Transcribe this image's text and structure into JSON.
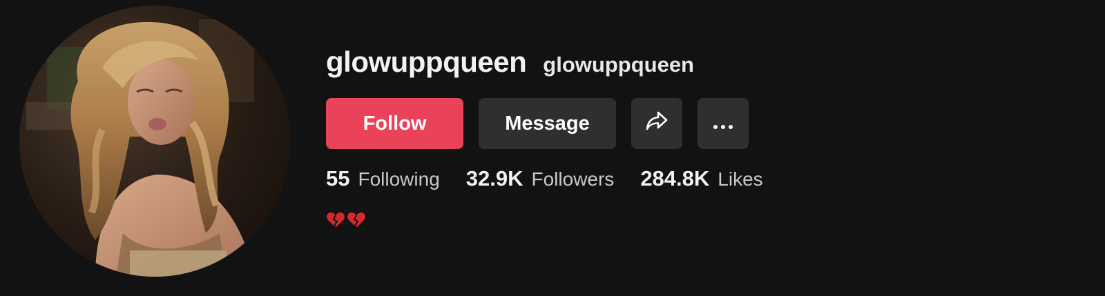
{
  "profile": {
    "username": "glowuppqueen",
    "nickname": "glowuppqueen",
    "avatar_icon": "profile-photo"
  },
  "actions": {
    "follow_label": "Follow",
    "message_label": "Message",
    "share_icon": "share-arrow-icon",
    "more_icon": "more-dots-icon"
  },
  "stats": {
    "following": {
      "count": "55",
      "label": "Following"
    },
    "followers": {
      "count": "32.9K",
      "label": "Followers"
    },
    "likes": {
      "count": "284.8K",
      "label": "Likes"
    }
  },
  "bio": {
    "emoji_icon": "broken-heart-icon"
  },
  "colors": {
    "background": "#121212",
    "follow_button": "#ea4359",
    "secondary_button": "#2f2f2f"
  }
}
